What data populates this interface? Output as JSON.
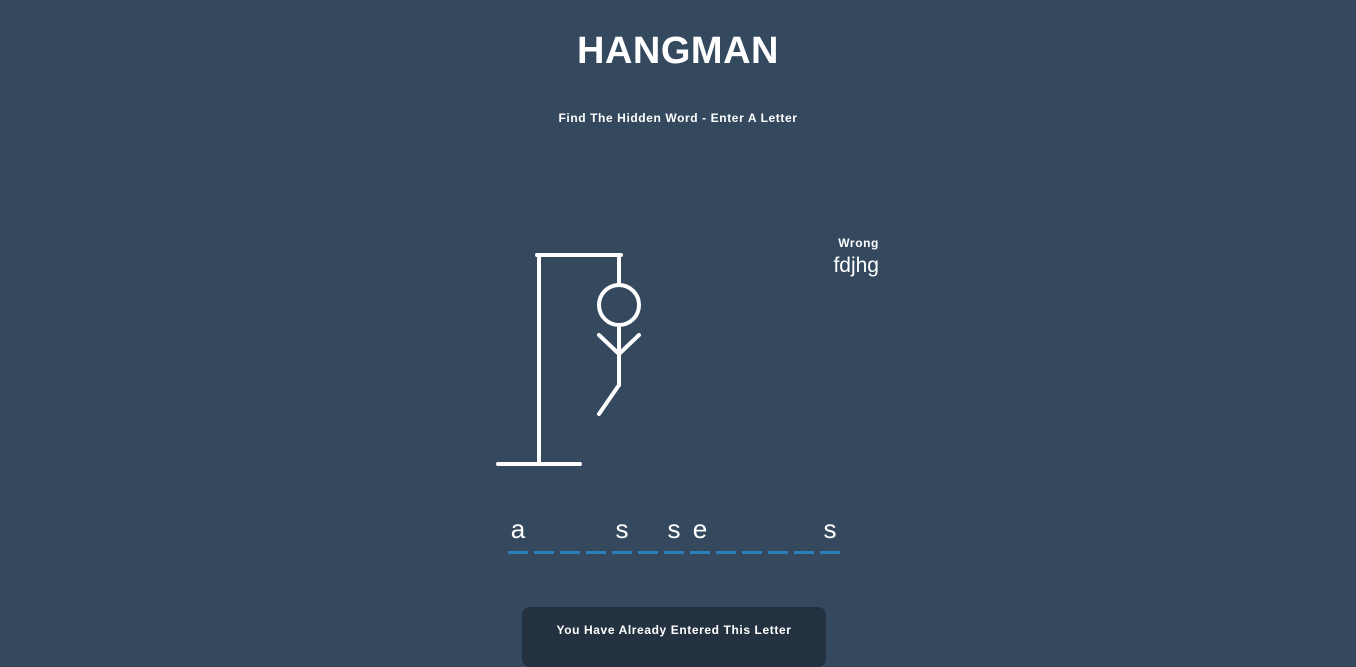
{
  "game": {
    "title": "HANGMAN",
    "subtitle": "Find The Hidden Word - Enter A Letter",
    "wrong": {
      "label": "Wrong",
      "letters": "fdjhg"
    },
    "word_slots": [
      "a",
      "",
      "",
      "",
      "s",
      "",
      "s",
      "e",
      "",
      "",
      "",
      "",
      "s"
    ],
    "wrong_guess_count": 5,
    "notification": "You Have Already Entered This Letter"
  },
  "colors": {
    "background": "#34495e",
    "text": "#ffffff",
    "underline": "#2980b9",
    "notification_bg": "#233140"
  }
}
